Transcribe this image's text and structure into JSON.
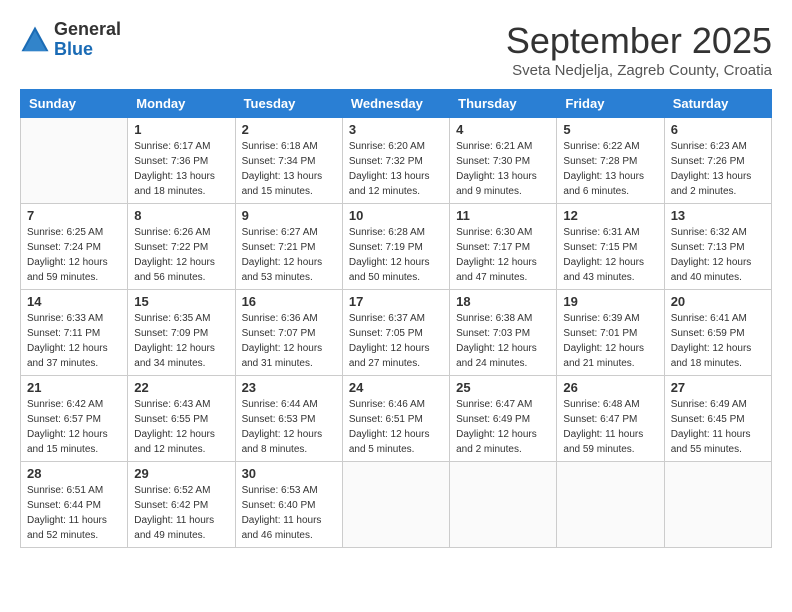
{
  "header": {
    "logo_general": "General",
    "logo_blue": "Blue",
    "month_title": "September 2025",
    "subtitle": "Sveta Nedjelja, Zagreb County, Croatia"
  },
  "days_of_week": [
    "Sunday",
    "Monday",
    "Tuesday",
    "Wednesday",
    "Thursday",
    "Friday",
    "Saturday"
  ],
  "weeks": [
    [
      {
        "day": "",
        "info": ""
      },
      {
        "day": "1",
        "info": "Sunrise: 6:17 AM\nSunset: 7:36 PM\nDaylight: 13 hours\nand 18 minutes."
      },
      {
        "day": "2",
        "info": "Sunrise: 6:18 AM\nSunset: 7:34 PM\nDaylight: 13 hours\nand 15 minutes."
      },
      {
        "day": "3",
        "info": "Sunrise: 6:20 AM\nSunset: 7:32 PM\nDaylight: 13 hours\nand 12 minutes."
      },
      {
        "day": "4",
        "info": "Sunrise: 6:21 AM\nSunset: 7:30 PM\nDaylight: 13 hours\nand 9 minutes."
      },
      {
        "day": "5",
        "info": "Sunrise: 6:22 AM\nSunset: 7:28 PM\nDaylight: 13 hours\nand 6 minutes."
      },
      {
        "day": "6",
        "info": "Sunrise: 6:23 AM\nSunset: 7:26 PM\nDaylight: 13 hours\nand 2 minutes."
      }
    ],
    [
      {
        "day": "7",
        "info": "Sunrise: 6:25 AM\nSunset: 7:24 PM\nDaylight: 12 hours\nand 59 minutes."
      },
      {
        "day": "8",
        "info": "Sunrise: 6:26 AM\nSunset: 7:22 PM\nDaylight: 12 hours\nand 56 minutes."
      },
      {
        "day": "9",
        "info": "Sunrise: 6:27 AM\nSunset: 7:21 PM\nDaylight: 12 hours\nand 53 minutes."
      },
      {
        "day": "10",
        "info": "Sunrise: 6:28 AM\nSunset: 7:19 PM\nDaylight: 12 hours\nand 50 minutes."
      },
      {
        "day": "11",
        "info": "Sunrise: 6:30 AM\nSunset: 7:17 PM\nDaylight: 12 hours\nand 47 minutes."
      },
      {
        "day": "12",
        "info": "Sunrise: 6:31 AM\nSunset: 7:15 PM\nDaylight: 12 hours\nand 43 minutes."
      },
      {
        "day": "13",
        "info": "Sunrise: 6:32 AM\nSunset: 7:13 PM\nDaylight: 12 hours\nand 40 minutes."
      }
    ],
    [
      {
        "day": "14",
        "info": "Sunrise: 6:33 AM\nSunset: 7:11 PM\nDaylight: 12 hours\nand 37 minutes."
      },
      {
        "day": "15",
        "info": "Sunrise: 6:35 AM\nSunset: 7:09 PM\nDaylight: 12 hours\nand 34 minutes."
      },
      {
        "day": "16",
        "info": "Sunrise: 6:36 AM\nSunset: 7:07 PM\nDaylight: 12 hours\nand 31 minutes."
      },
      {
        "day": "17",
        "info": "Sunrise: 6:37 AM\nSunset: 7:05 PM\nDaylight: 12 hours\nand 27 minutes."
      },
      {
        "day": "18",
        "info": "Sunrise: 6:38 AM\nSunset: 7:03 PM\nDaylight: 12 hours\nand 24 minutes."
      },
      {
        "day": "19",
        "info": "Sunrise: 6:39 AM\nSunset: 7:01 PM\nDaylight: 12 hours\nand 21 minutes."
      },
      {
        "day": "20",
        "info": "Sunrise: 6:41 AM\nSunset: 6:59 PM\nDaylight: 12 hours\nand 18 minutes."
      }
    ],
    [
      {
        "day": "21",
        "info": "Sunrise: 6:42 AM\nSunset: 6:57 PM\nDaylight: 12 hours\nand 15 minutes."
      },
      {
        "day": "22",
        "info": "Sunrise: 6:43 AM\nSunset: 6:55 PM\nDaylight: 12 hours\nand 12 minutes."
      },
      {
        "day": "23",
        "info": "Sunrise: 6:44 AM\nSunset: 6:53 PM\nDaylight: 12 hours\nand 8 minutes."
      },
      {
        "day": "24",
        "info": "Sunrise: 6:46 AM\nSunset: 6:51 PM\nDaylight: 12 hours\nand 5 minutes."
      },
      {
        "day": "25",
        "info": "Sunrise: 6:47 AM\nSunset: 6:49 PM\nDaylight: 12 hours\nand 2 minutes."
      },
      {
        "day": "26",
        "info": "Sunrise: 6:48 AM\nSunset: 6:47 PM\nDaylight: 11 hours\nand 59 minutes."
      },
      {
        "day": "27",
        "info": "Sunrise: 6:49 AM\nSunset: 6:45 PM\nDaylight: 11 hours\nand 55 minutes."
      }
    ],
    [
      {
        "day": "28",
        "info": "Sunrise: 6:51 AM\nSunset: 6:44 PM\nDaylight: 11 hours\nand 52 minutes."
      },
      {
        "day": "29",
        "info": "Sunrise: 6:52 AM\nSunset: 6:42 PM\nDaylight: 11 hours\nand 49 minutes."
      },
      {
        "day": "30",
        "info": "Sunrise: 6:53 AM\nSunset: 6:40 PM\nDaylight: 11 hours\nand 46 minutes."
      },
      {
        "day": "",
        "info": ""
      },
      {
        "day": "",
        "info": ""
      },
      {
        "day": "",
        "info": ""
      },
      {
        "day": "",
        "info": ""
      }
    ]
  ]
}
